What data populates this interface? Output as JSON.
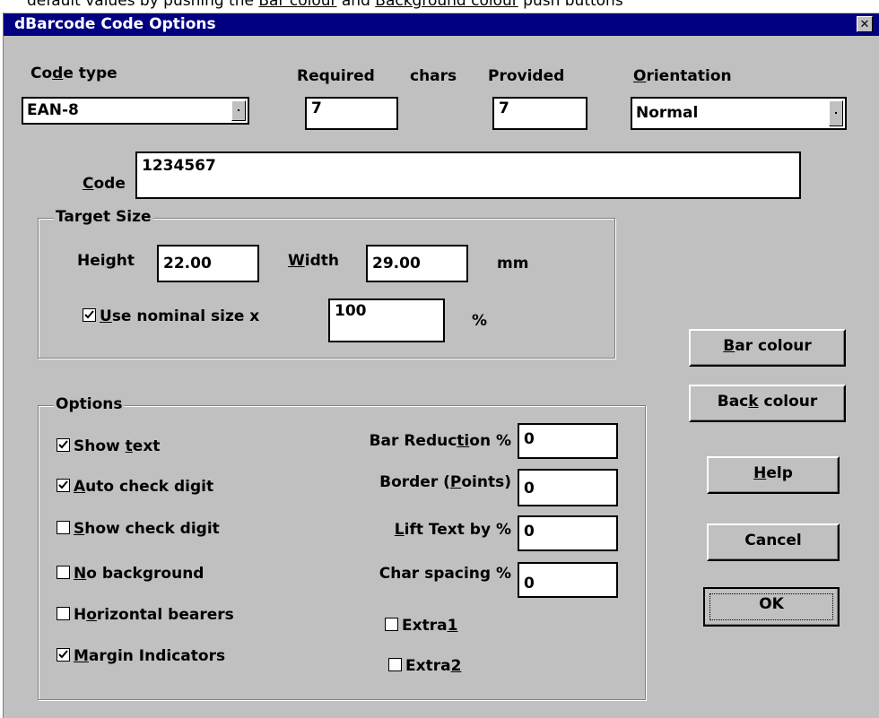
{
  "background_note_text": {
    "prefix": "default values by pushing the ",
    "link1": "Bar colour",
    "mid": " and ",
    "link2": "Background colour",
    "suffix": " push buttons"
  },
  "window": {
    "title": "dBarcode Code Options",
    "close_glyph": "✕"
  },
  "code_type": {
    "label_pre": "Co",
    "label_key": "d",
    "label_post": "e type",
    "value": "EAN-8"
  },
  "required": {
    "label": "Required",
    "chars_label": "chars",
    "value": "7"
  },
  "provided": {
    "label": "Provided",
    "value": "7"
  },
  "orientation": {
    "label_key": "O",
    "label_post": "rientation",
    "value": "Normal"
  },
  "code": {
    "label_key": "C",
    "label_post": "ode",
    "value": "1234567"
  },
  "target_size": {
    "title": "Target Size",
    "height_label_pre": "Hei",
    "height_label_key": "g",
    "height_label_post": "ht",
    "height_value": "22.00",
    "width_label_key": "W",
    "width_label_post": "idth",
    "width_value": "29.00",
    "unit": "mm",
    "nominal_label_key": "U",
    "nominal_label_post": "se nominal size x",
    "nominal_checked": true,
    "nominal_value": "100",
    "percent": "%"
  },
  "options": {
    "title": "Options",
    "show_text": {
      "pre": "Show ",
      "key": "t",
      "post": "ext",
      "checked": true
    },
    "auto_check": {
      "pre": "",
      "key": "A",
      "post": "uto check digit",
      "checked": true
    },
    "show_check": {
      "pre": "",
      "key": "S",
      "post": "how check digit",
      "checked": false
    },
    "no_background": {
      "pre": "",
      "key": "N",
      "post": "o background",
      "checked": false
    },
    "horizontal_bearers": {
      "pre": "H",
      "key": "o",
      "post": "rizontal bearers",
      "checked": false
    },
    "margin_indicators": {
      "pre": "",
      "key": "M",
      "post": "argin Indicators",
      "checked": true
    },
    "bar_reduction": {
      "pre": "Bar Reduc",
      "key": "ti",
      "post": "on %",
      "value": "0"
    },
    "border": {
      "pre": "Border (",
      "key": "P",
      "post": "oints)",
      "value": "0"
    },
    "lift_text": {
      "pre": "",
      "key": "L",
      "post": "ift Text by %",
      "value": "0"
    },
    "char_spacing": {
      "label": "Char spacing %",
      "value": "0"
    },
    "extra1": {
      "pre": "Extra",
      "key": "1",
      "checked": false
    },
    "extra2": {
      "pre": "Extra",
      "key": "2",
      "checked": false
    }
  },
  "buttons": {
    "bar_colour": {
      "key": "B",
      "post": "ar colour"
    },
    "back_colour": {
      "pre": "Bac",
      "key": "k",
      "post": " colour"
    },
    "help": {
      "key": "H",
      "post": "elp"
    },
    "cancel": {
      "label": "Cancel"
    },
    "ok": {
      "label": "OK"
    }
  }
}
